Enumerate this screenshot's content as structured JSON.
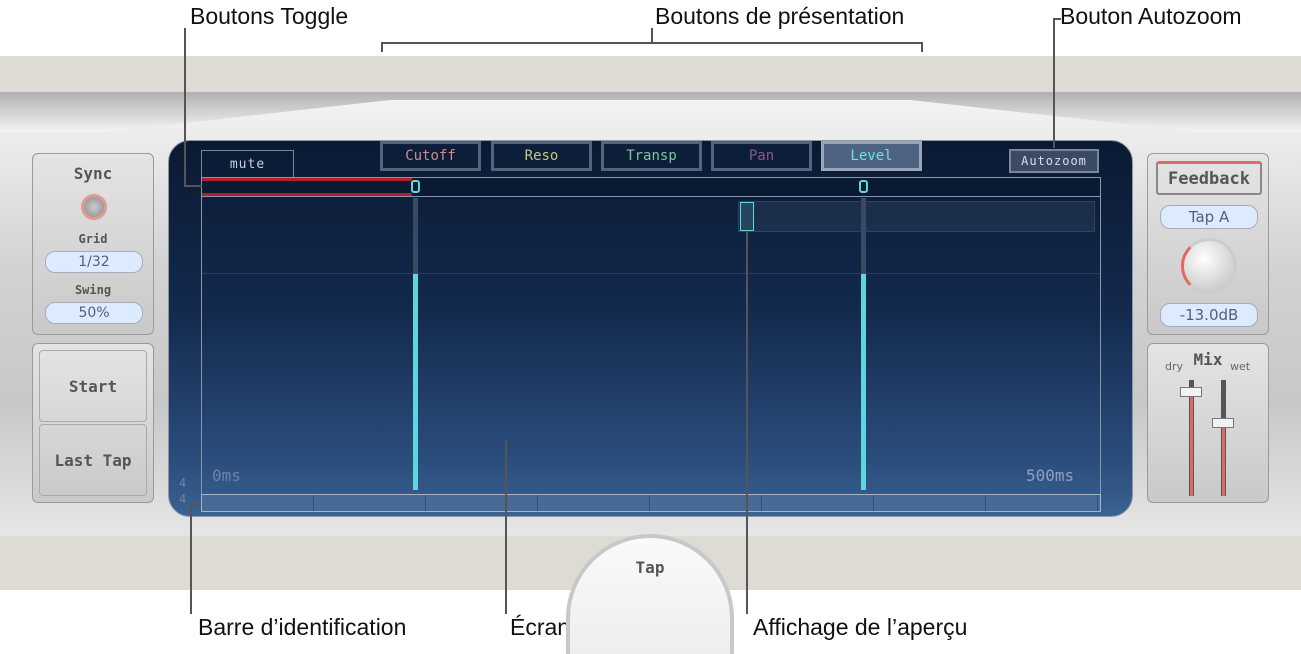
{
  "callouts": {
    "toggle": "Boutons Toggle",
    "view": "Boutons de présentation",
    "autozoom": "Bouton Autozoom",
    "id_bar": "Barre d’identification",
    "tap_screen": "Écran Tap",
    "overview": "Affichage de l’aperçu"
  },
  "left": {
    "sync": "Sync",
    "grid_label": "Grid",
    "grid_value": "1/32",
    "swing_label": "Swing",
    "swing_value": "50%",
    "start": "Start",
    "last_tap": "Last Tap"
  },
  "screen": {
    "mute_tab": "mute",
    "view_buttons": [
      {
        "label": "Cutoff",
        "color": "#d08a8a"
      },
      {
        "label": "Reso",
        "color": "#c9c77a"
      },
      {
        "label": "Transp",
        "color": "#7cc89a"
      },
      {
        "label": "Pan",
        "color": "#8a5a8a"
      },
      {
        "label": "Level",
        "color": "#6fe0e8",
        "active": true
      }
    ],
    "autozoom": "Autozoom",
    "time_start": "0ms",
    "time_end": "500ms",
    "time_signature_top": "4",
    "time_signature_bottom": "4",
    "taps": [
      {
        "id": "A",
        "level_percent": 74
      },
      {
        "id": "B",
        "level_percent": 74
      }
    ],
    "accent": "#5fd6dc"
  },
  "right": {
    "feedback": "Feedback",
    "tap_select": "Tap A",
    "feedback_value": "-13.0dB",
    "mix": "Mix",
    "dry": "dry",
    "wet": "wet",
    "dry_level_percent": 90,
    "wet_level_percent": 63
  },
  "tap_button": "Tap"
}
